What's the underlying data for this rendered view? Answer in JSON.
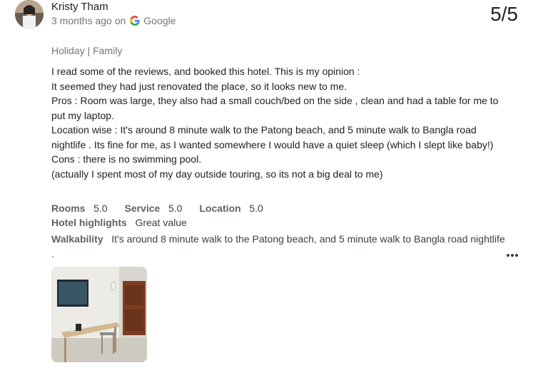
{
  "review": {
    "reviewer_name": "Kristy Tham",
    "time_ago": "3 months ago on",
    "source": "Google",
    "rating": "5/5",
    "trip_type": "Holiday | Family",
    "text_lines": [
      "I read some of the reviews, and booked this hotel. This is my opinion :",
      "It seemed they had just renovated the place, so it looks new to me.",
      "Pros : Room was large, they also had a small couch/bed on the side , clean and had a table for me to put my laptop.",
      "Location wise : It's around 8 minute walk to the Patong beach, and 5 minute walk to Bangla road nightlife . Its fine for me, as I wanted somewhere I would have a quiet sleep (which I slept like baby!)",
      "Cons : there is no swimming pool.",
      "(actually I spent most of my day outside touring, so its not a big deal to me)"
    ],
    "ratings": {
      "rooms_label": "Rooms",
      "rooms_value": "5.0",
      "service_label": "Service",
      "service_value": "5.0",
      "location_label": "Location",
      "location_value": "5.0"
    },
    "highlights_label": "Hotel highlights",
    "highlights_value": "Great value",
    "walkability_label": "Walkability",
    "walkability_value": "It's around 8 minute walk to the Patong beach, and 5 minute walk to Bangla road nightlife .",
    "more_icon": "more-horizontal-icon",
    "source_icon": "google-g-icon"
  }
}
